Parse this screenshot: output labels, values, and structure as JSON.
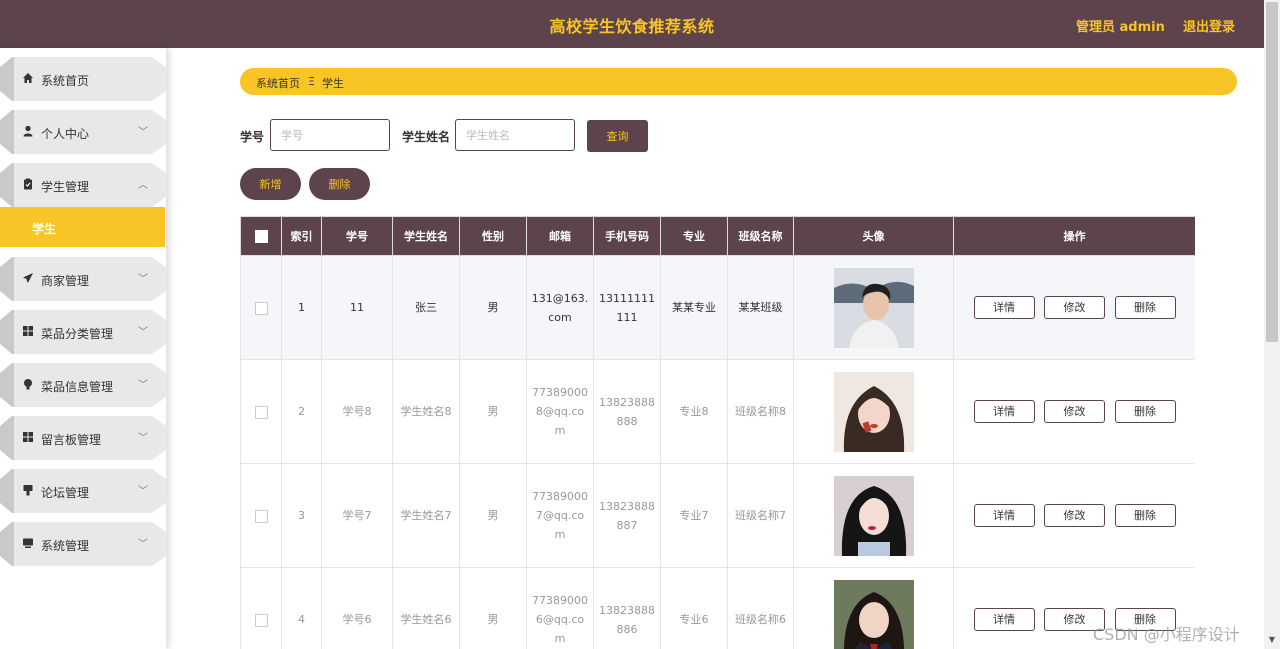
{
  "header": {
    "title": "高校学生饮食推荐系统",
    "admin": "管理员 admin",
    "logout": "退出登录"
  },
  "sidebar": {
    "items": [
      {
        "label": "系统首页",
        "icon": "home-icon"
      },
      {
        "label": "个人中心",
        "icon": "user-icon"
      },
      {
        "label": "学生管理",
        "icon": "clipboard-icon",
        "expanded": true
      },
      {
        "label": "商家管理",
        "icon": "send-icon"
      },
      {
        "label": "菜品分类管理",
        "icon": "grid-icon"
      },
      {
        "label": "菜品信息管理",
        "icon": "bulb-icon"
      },
      {
        "label": "留言板管理",
        "icon": "grid-icon"
      },
      {
        "label": "论坛管理",
        "icon": "flag-icon"
      },
      {
        "label": "系统管理",
        "icon": "monitor-icon"
      }
    ],
    "sub_active": "学生"
  },
  "breadcrumb": {
    "home": "系统首页",
    "sep": "Ξ",
    "current": "学生"
  },
  "search": {
    "id_label": "学号",
    "id_placeholder": "学号",
    "name_label": "学生姓名",
    "name_placeholder": "学生姓名",
    "query_label": "查询"
  },
  "actions": {
    "add": "新增",
    "delete": "删除"
  },
  "table": {
    "headers": [
      "索引",
      "学号",
      "学生姓名",
      "性别",
      "邮箱",
      "手机号码",
      "专业",
      "班级名称",
      "头像",
      "操作"
    ],
    "row_actions": {
      "detail": "详情",
      "edit": "修改",
      "delete": "删除"
    },
    "rows": [
      {
        "index": "1",
        "student_id": "11",
        "name": "张三",
        "gender": "男",
        "email": "131@163.com",
        "phone": "13111111111",
        "major": "某某专业",
        "class": "某某班级"
      },
      {
        "index": "2",
        "student_id": "学号8",
        "name": "学生姓名8",
        "gender": "男",
        "email": "773890008@qq.com",
        "phone": "13823888888",
        "major": "专业8",
        "class": "班级名称8"
      },
      {
        "index": "3",
        "student_id": "学号7",
        "name": "学生姓名7",
        "gender": "男",
        "email": "773890007@qq.com",
        "phone": "13823888887",
        "major": "专业7",
        "class": "班级名称7"
      },
      {
        "index": "4",
        "student_id": "学号6",
        "name": "学生姓名6",
        "gender": "男",
        "email": "773890006@qq.com",
        "phone": "13823888886",
        "major": "专业6",
        "class": "班级名称6"
      }
    ]
  },
  "watermark": "CSDN @小程序设计",
  "colors": {
    "primary": "#5c434c",
    "accent": "#f8c426"
  }
}
